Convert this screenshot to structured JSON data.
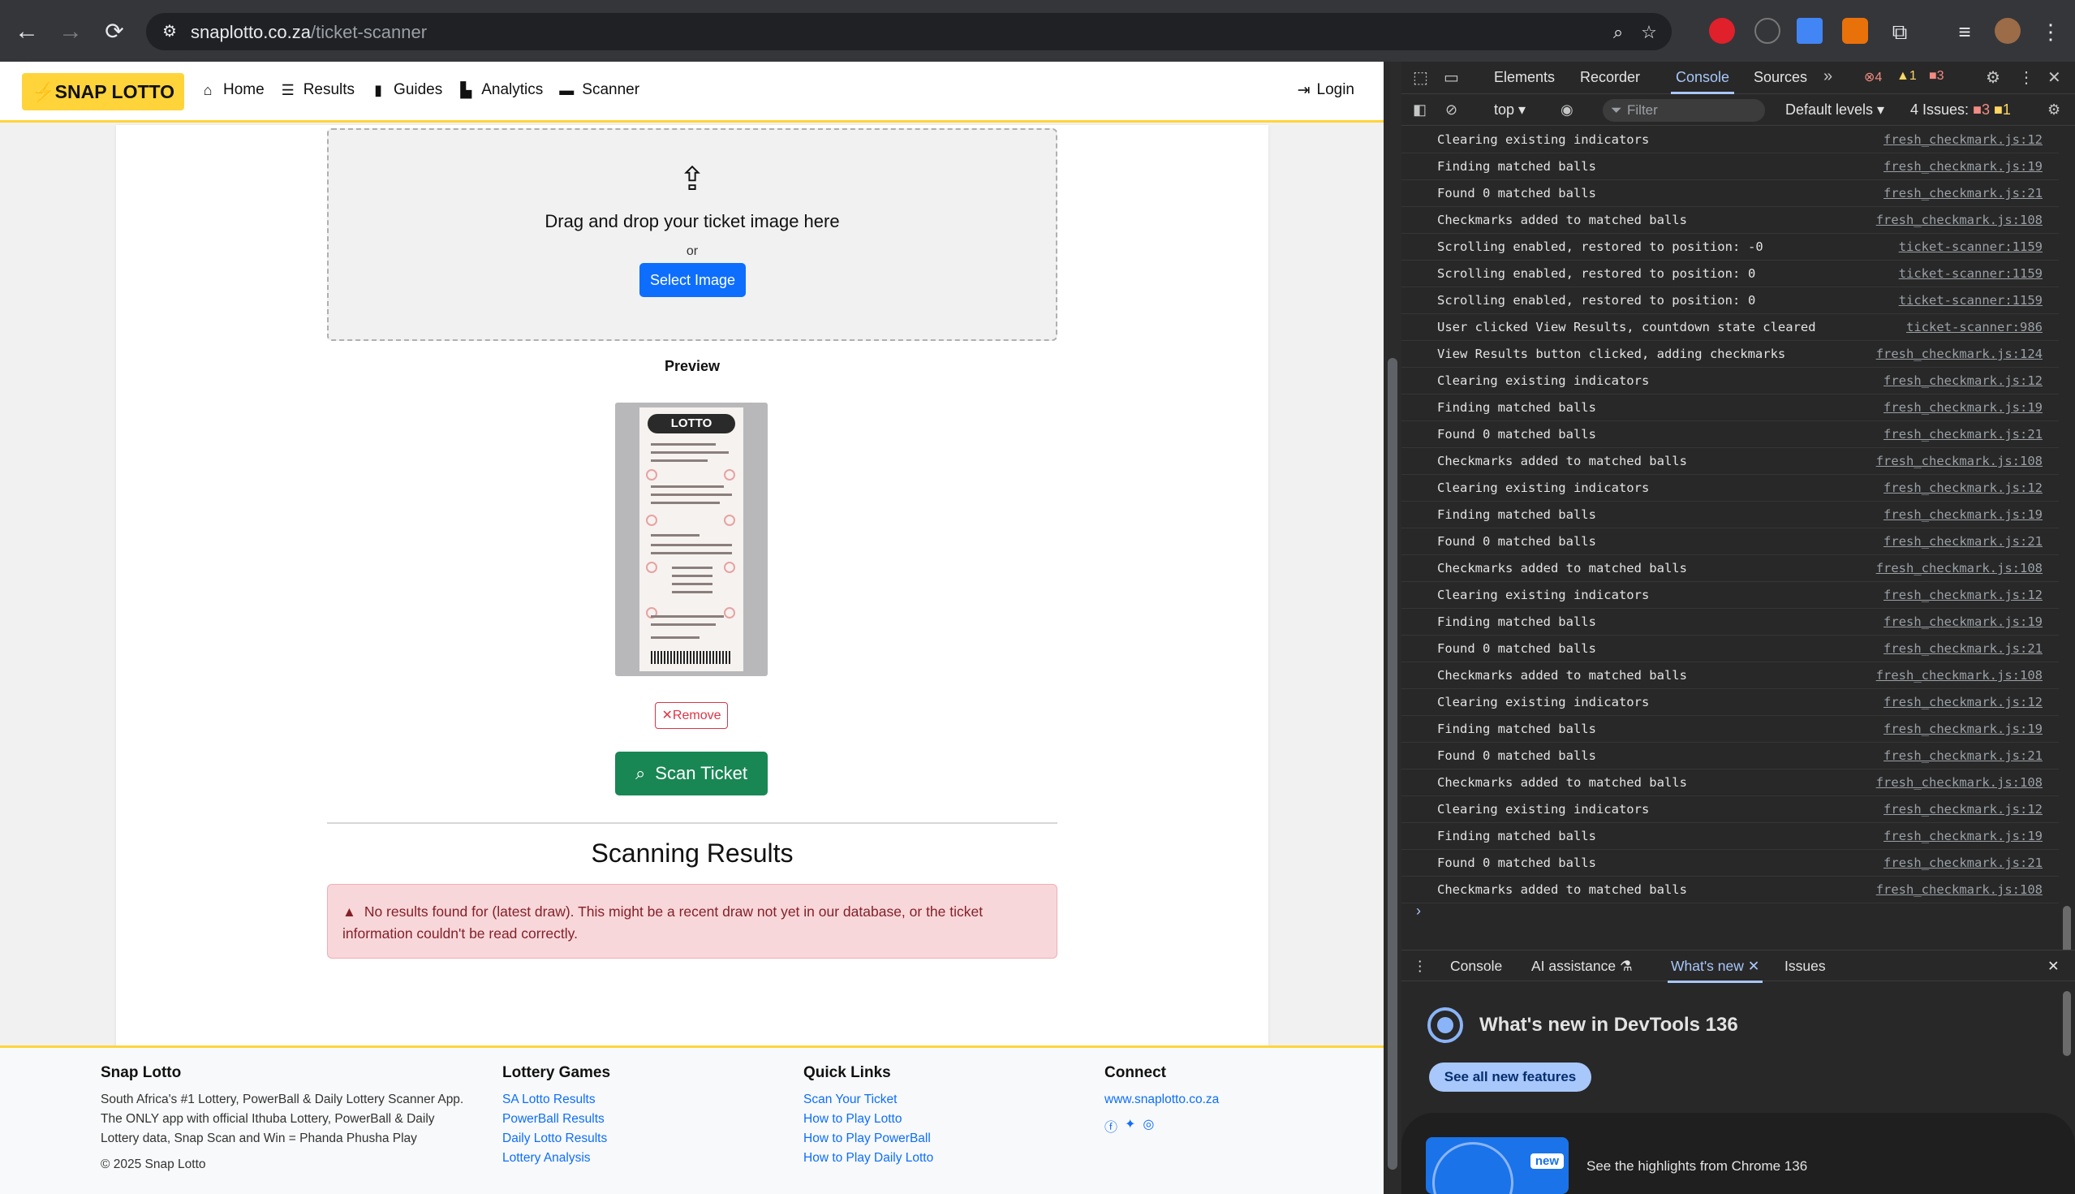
{
  "browser": {
    "url_domain": "snaplotto.co.za",
    "url_path": "/ticket-scanner"
  },
  "site": {
    "brand": "SNAP LOTTO",
    "nav": [
      {
        "label": "Home",
        "icon": "home-icon"
      },
      {
        "label": "Results",
        "icon": "list-icon"
      },
      {
        "label": "Guides",
        "icon": "book-icon"
      },
      {
        "label": "Analytics",
        "icon": "chart-icon"
      },
      {
        "label": "Scanner",
        "icon": "ticket-icon"
      }
    ],
    "login": "Login"
  },
  "scanner": {
    "drop_title": "Drag and drop your ticket image here",
    "or": "or",
    "select_button": "Select Image",
    "preview_label": "Preview",
    "ticket_logo": "LOTTO",
    "remove_button": "Remove",
    "scan_button": "Scan Ticket",
    "results_title": "Scanning Results",
    "alert_text": "No results found for (latest draw). This might be a recent draw not yet in our database, or the ticket information couldn't be read correctly."
  },
  "footer": {
    "about": {
      "heading": "Snap Lotto",
      "lines": [
        "South Africa's #1 Lottery, PowerBall & Daily Lottery Scanner App.",
        "The ONLY app with official Ithuba Lottery, PowerBall & Daily",
        "Lottery data, Snap Scan and Win = Phanda Phusha Play"
      ],
      "copyright": "© 2025 Snap Lotto"
    },
    "games": {
      "heading": "Lottery Games",
      "links": [
        "SA Lotto Results",
        "PowerBall Results",
        "Daily Lotto Results",
        "Lottery Analysis"
      ]
    },
    "quick": {
      "heading": "Quick Links",
      "links": [
        "Scan Your Ticket",
        "How to Play Lotto",
        "How to Play PowerBall",
        "How to Play Daily Lotto"
      ]
    },
    "connect": {
      "heading": "Connect",
      "link": "www.snaplotto.co.za"
    }
  },
  "devtools": {
    "tabs": [
      "Elements",
      "Recorder",
      "Console",
      "Sources"
    ],
    "active_tab": "Console",
    "errors": "4",
    "warnings": "1",
    "info": "3",
    "context": "top ▾",
    "filter_placeholder": "Filter",
    "levels": "Default levels ▾",
    "issues_label": "4 Issues:",
    "issues_errors": "3",
    "issues_warnings": "1",
    "logs": [
      {
        "msg": "Clearing existing indicators",
        "src": "fresh_checkmark.js:12"
      },
      {
        "msg": "Finding matched balls",
        "src": "fresh_checkmark.js:19"
      },
      {
        "msg": "Found 0 matched balls",
        "src": "fresh_checkmark.js:21"
      },
      {
        "msg": "Checkmarks added to matched balls",
        "src": "fresh_checkmark.js:108"
      },
      {
        "msg": "Scrolling enabled, restored to position:",
        "num": "-0",
        "src": "ticket-scanner:1159"
      },
      {
        "msg": "Scrolling enabled, restored to position:",
        "num": "0",
        "src": "ticket-scanner:1159"
      },
      {
        "msg": "Scrolling enabled, restored to position:",
        "num": "0",
        "src": "ticket-scanner:1159"
      },
      {
        "msg": "User clicked View Results, countdown state cleared",
        "src": "ticket-scanner:986"
      },
      {
        "msg": "View Results button clicked, adding checkmarks",
        "src": "fresh_checkmark.js:124"
      },
      {
        "msg": "Clearing existing indicators",
        "src": "fresh_checkmark.js:12"
      },
      {
        "msg": "Finding matched balls",
        "src": "fresh_checkmark.js:19"
      },
      {
        "msg": "Found 0 matched balls",
        "src": "fresh_checkmark.js:21"
      },
      {
        "msg": "Checkmarks added to matched balls",
        "src": "fresh_checkmark.js:108"
      },
      {
        "msg": "Clearing existing indicators",
        "src": "fresh_checkmark.js:12"
      },
      {
        "msg": "Finding matched balls",
        "src": "fresh_checkmark.js:19"
      },
      {
        "msg": "Found 0 matched balls",
        "src": "fresh_checkmark.js:21"
      },
      {
        "msg": "Checkmarks added to matched balls",
        "src": "fresh_checkmark.js:108"
      },
      {
        "msg": "Clearing existing indicators",
        "src": "fresh_checkmark.js:12"
      },
      {
        "msg": "Finding matched balls",
        "src": "fresh_checkmark.js:19"
      },
      {
        "msg": "Found 0 matched balls",
        "src": "fresh_checkmark.js:21"
      },
      {
        "msg": "Checkmarks added to matched balls",
        "src": "fresh_checkmark.js:108"
      },
      {
        "msg": "Clearing existing indicators",
        "src": "fresh_checkmark.js:12"
      },
      {
        "msg": "Finding matched balls",
        "src": "fresh_checkmark.js:19"
      },
      {
        "msg": "Found 0 matched balls",
        "src": "fresh_checkmark.js:21"
      },
      {
        "msg": "Checkmarks added to matched balls",
        "src": "fresh_checkmark.js:108"
      },
      {
        "msg": "Clearing existing indicators",
        "src": "fresh_checkmark.js:12"
      },
      {
        "msg": "Finding matched balls",
        "src": "fresh_checkmark.js:19"
      },
      {
        "msg": "Found 0 matched balls",
        "src": "fresh_checkmark.js:21"
      },
      {
        "msg": "Checkmarks added to matched balls",
        "src": "fresh_checkmark.js:108"
      }
    ],
    "drawer_tabs": [
      "Console",
      "AI assistance",
      "What's new",
      "Issues"
    ],
    "drawer_active": "What's new",
    "whats_new_title": "What's new in DevTools 136",
    "see_all": "See all new features",
    "new_badge": "new",
    "highlight": "See the highlights from Chrome 136"
  },
  "colors": {
    "brand_yellow": "#ffd43b",
    "primary_blue": "#0d6efd",
    "success_green": "#198754",
    "danger_red": "#dc3545",
    "devtools_accent": "#a8c7fa"
  }
}
